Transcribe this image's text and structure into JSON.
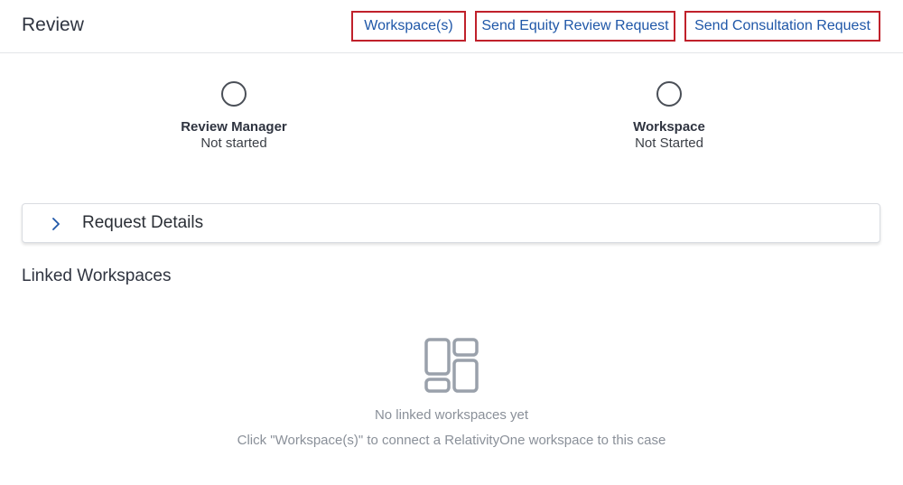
{
  "header": {
    "title": "Review",
    "buttons": {
      "workspaces": "Workspace(s)",
      "equity_review": "Send Equity Review Request",
      "consultation": "Send Consultation Request"
    },
    "button_border_color": "#c0212b",
    "button_text_color": "#1f57a8"
  },
  "steps": [
    {
      "title": "Review Manager",
      "status": "Not started"
    },
    {
      "title": "Workspace",
      "status": "Not Started"
    }
  ],
  "accordion": {
    "label": "Request Details",
    "icon": "chevron-right-icon"
  },
  "linked_workspaces": {
    "title": "Linked Workspaces",
    "empty_icon": "workspaces-grid-icon",
    "empty_message": "No linked workspaces yet",
    "empty_hint": "Click \"Workspace(s)\" to connect a RelativityOne workspace to this case"
  }
}
